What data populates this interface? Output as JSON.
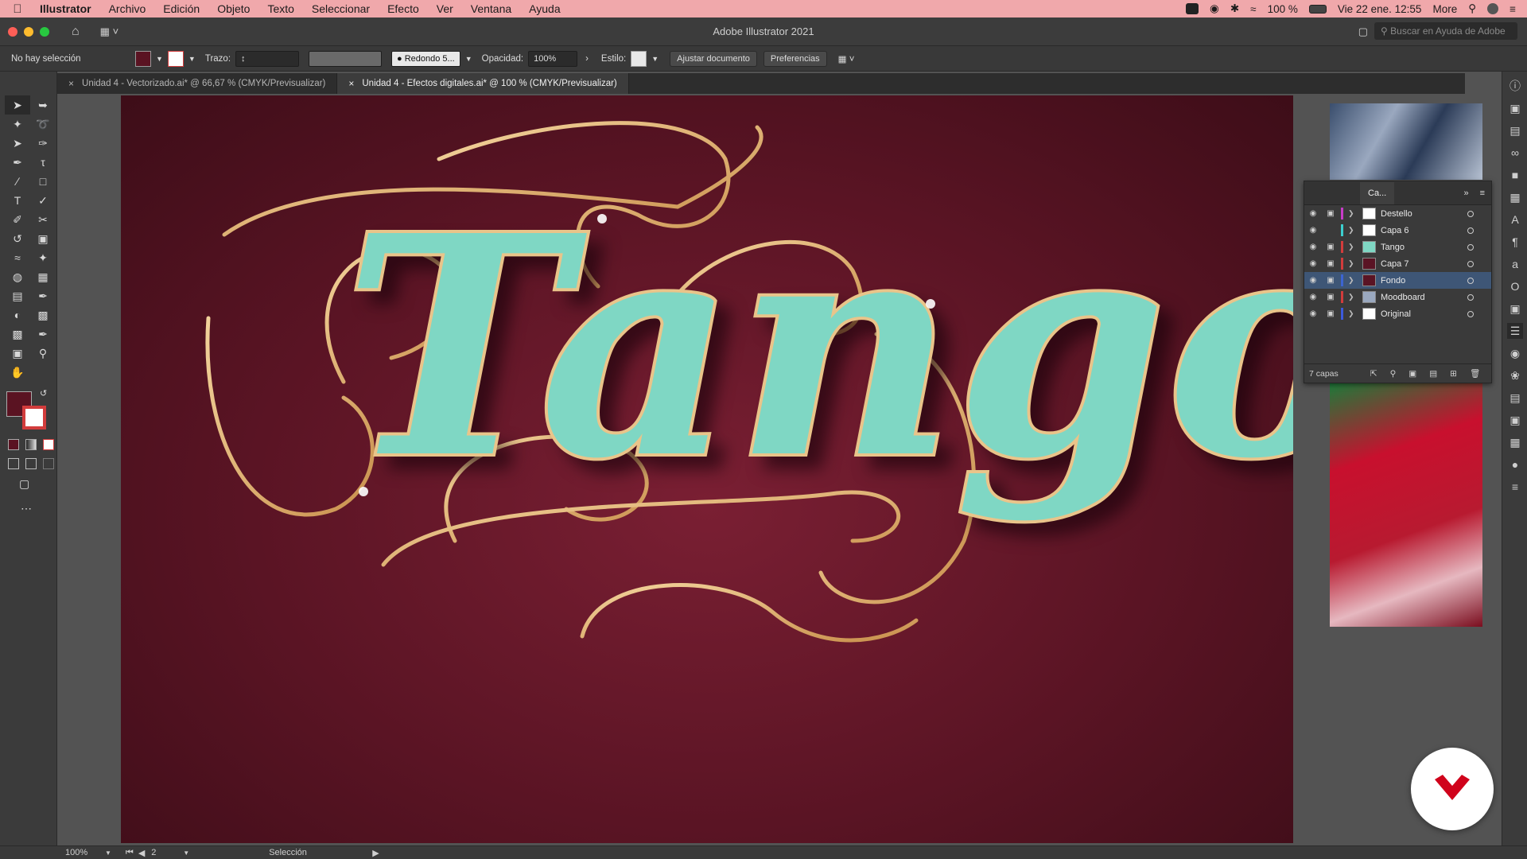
{
  "menubar": {
    "apple": "",
    "app": "Illustrator",
    "items": [
      "Archivo",
      "Edición",
      "Objeto",
      "Texto",
      "Seleccionar",
      "Efecto",
      "Ver",
      "Ventana",
      "Ayuda"
    ],
    "battery": "100 %",
    "datetime": "Vie 22 ene.  12:55",
    "more": "More"
  },
  "window": {
    "title": "Adobe Illustrator 2021",
    "search_placeholder": "Buscar en Ayuda de Adobe"
  },
  "control": {
    "selection_status": "No hay selección",
    "stroke_label": "Trazo:",
    "brush_value": "Redondo 5...",
    "opacity_label": "Opacidad:",
    "opacity_value": "100%",
    "style_label": "Estilo:",
    "fit_button": "Ajustar documento",
    "prefs_button": "Preferencias"
  },
  "tabs": [
    {
      "label": "Unidad 4 - Vectorizado.ai* @ 66,67 % (CMYK/Previsualizar)"
    },
    {
      "label": "Unidad 4 - Efectos digitales.ai* @ 100 % (CMYK/Previsualizar)"
    }
  ],
  "artwork": {
    "lettering": "Tango"
  },
  "layers_panel": {
    "tab": "Ca...",
    "layers": [
      {
        "name": "Destello",
        "color": "#c83cc8"
      },
      {
        "name": "Capa 6",
        "color": "#3ccfcf"
      },
      {
        "name": "Tango",
        "color": "#d23c3c"
      },
      {
        "name": "Capa 7",
        "color": "#d23c3c"
      },
      {
        "name": "Fondo",
        "color": "#3c64d2"
      },
      {
        "name": "Moodboard",
        "color": "#d23c3c"
      },
      {
        "name": "Original",
        "color": "#3c5adc"
      }
    ],
    "count": "7 capas"
  },
  "status": {
    "zoom": "100%",
    "artboard_number": "2",
    "tool_name": "Selección"
  },
  "colors": {
    "menubar": "#f0a8ab",
    "artboard": "#5a1424",
    "letter_fill": "#7fd7c4",
    "letter_outline": "#e9c48a"
  }
}
